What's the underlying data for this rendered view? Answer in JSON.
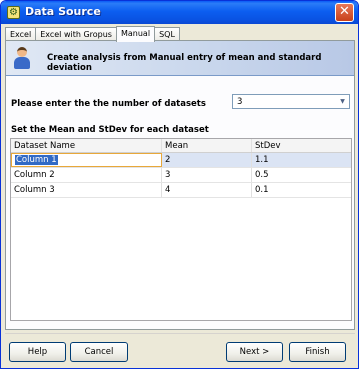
{
  "window": {
    "title": "Data Source"
  },
  "tabs": [
    {
      "label": "Excel"
    },
    {
      "label": "Excel with Gropus"
    },
    {
      "label": "Manual"
    },
    {
      "label": "SQL"
    }
  ],
  "banner": {
    "text": "Create analysis from Manual entry of mean and standard deviation"
  },
  "datasets": {
    "label": "Please enter the the number of datasets",
    "selected_value": "3"
  },
  "grid": {
    "section_label": "Set the Mean and StDev for each dataset",
    "columns": [
      "Dataset Name",
      "Mean",
      "StDev"
    ],
    "rows": [
      {
        "name": "Column 1",
        "mean": "2",
        "stdev": "1.1"
      },
      {
        "name": "Column 2",
        "mean": "3",
        "stdev": "0.5"
      },
      {
        "name": "Column 3",
        "mean": "4",
        "stdev": "0.1"
      }
    ]
  },
  "buttons": {
    "help": "Help",
    "cancel": "Cancel",
    "next": "Next >",
    "finish": "Finish"
  }
}
